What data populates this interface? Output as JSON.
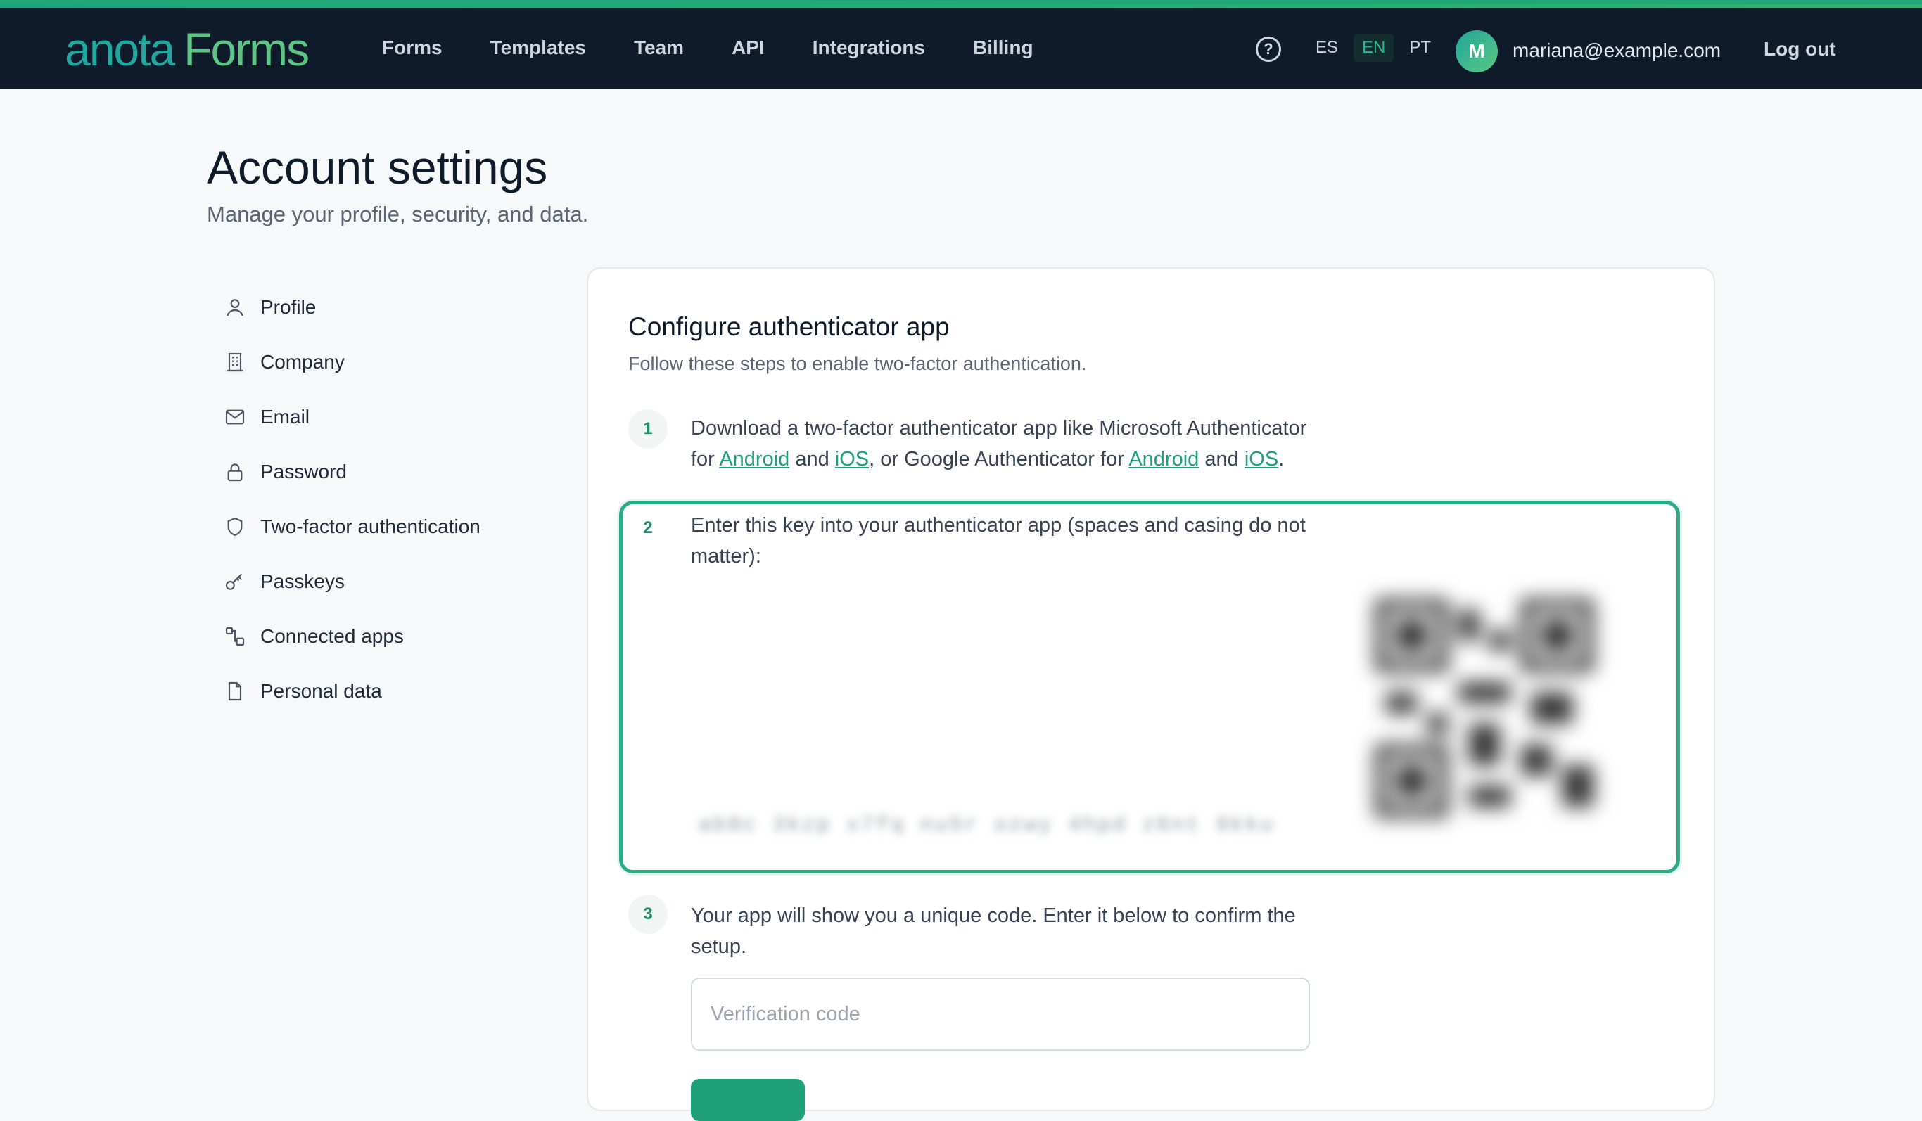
{
  "brand": {
    "part1": "anota",
    "part2": "Forms"
  },
  "nav": [
    "Forms",
    "Templates",
    "Team",
    "API",
    "Integrations",
    "Billing"
  ],
  "help_icon": "question-circle-icon",
  "languages": [
    {
      "code": "ES",
      "active": false
    },
    {
      "code": "EN",
      "active": true
    },
    {
      "code": "PT",
      "active": false
    }
  ],
  "user": {
    "initial": "M",
    "email": "mariana@example.com"
  },
  "logout_label": "Log out",
  "page": {
    "title": "Account settings",
    "subtitle": "Manage your profile, security, and data."
  },
  "sidebar": {
    "items": [
      {
        "label": "Profile",
        "icon": "user-icon"
      },
      {
        "label": "Company",
        "icon": "building-icon"
      },
      {
        "label": "Email",
        "icon": "envelope-icon"
      },
      {
        "label": "Password",
        "icon": "lock-icon"
      },
      {
        "label": "Two-factor authentication",
        "icon": "shield-icon"
      },
      {
        "label": "Passkeys",
        "icon": "key-icon"
      },
      {
        "label": "Connected apps",
        "icon": "link-icon"
      },
      {
        "label": "Personal data",
        "icon": "file-icon"
      }
    ]
  },
  "card": {
    "title": "Configure authenticator app",
    "subtitle": "Follow these steps to enable two-factor authentication.",
    "step1": {
      "number": "1",
      "line1": "Download a two-factor authenticator app like Microsoft Authenticator",
      "for": "for",
      "and1": "and",
      "or_google": ", or Google Authenticator for",
      "and2": "and",
      "period": ".",
      "link_android_ms": "Android",
      "link_ios_ms": "iOS",
      "link_android_g": "Android",
      "link_ios_g": "iOS"
    },
    "step2": {
      "number": "2",
      "text": "Enter this key into your authenticator app (spaces and casing do not matter):",
      "secret_key": "ab8c 3kzp x7fq nu5r ozwy 4hpd z6nt 9kku"
    },
    "step3": {
      "number": "3",
      "text": "Your app will show you a unique code. Enter it below to confirm the setup.",
      "placeholder": "Verification code"
    }
  }
}
